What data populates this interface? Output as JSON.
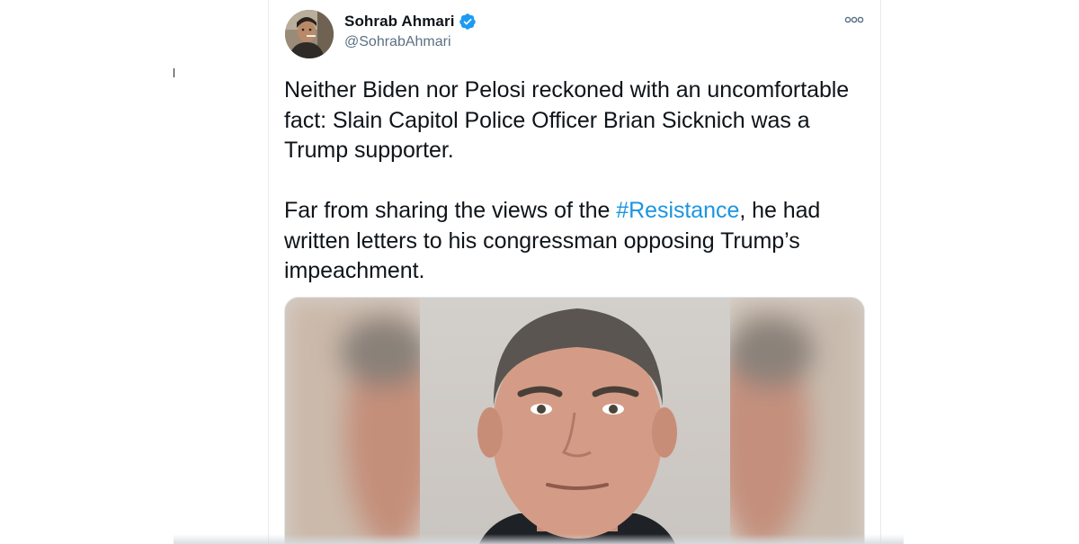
{
  "tweet": {
    "author": {
      "display_name": "Sohrab Ahmari",
      "handle": "@SohrabAhmari",
      "verified": true,
      "verified_color": "#1d9bf0"
    },
    "text": {
      "paragraph_1": "Neither Biden nor Pelosi reckoned with an uncomfortable fact: Slain Capitol Police Officer Brian Sicknich was a Trump supporter.",
      "paragraph_2_before": "Far from sharing the views of the ",
      "hashtag": "#Resistance",
      "paragraph_2_after": ", he had written letters to his congressman opposing Trump’s impeachment."
    },
    "hashtag_color": "#1b95e0",
    "menu_icon": "more-dots-icon",
    "media": {
      "type": "photo"
    }
  }
}
